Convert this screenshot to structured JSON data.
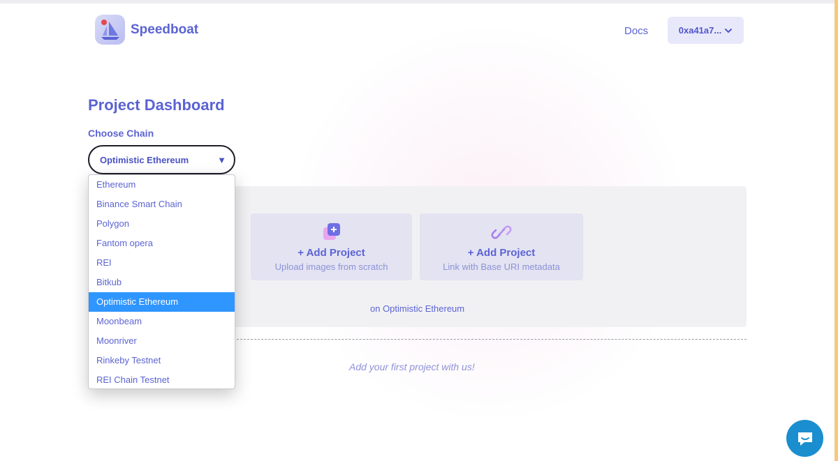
{
  "header": {
    "brand": "Speedboat",
    "docs_label": "Docs",
    "wallet_label": "0xa41a7..."
  },
  "main": {
    "title": "Project Dashboard",
    "choose_chain_label": "Choose Chain",
    "selected_chain": "Optimistic Ethereum",
    "chain_options": [
      "Ethereum",
      "Binance Smart Chain",
      "Polygon",
      "Fantom opera",
      "REI",
      "Bitkub",
      "Optimistic Ethereum",
      "Moonbeam",
      "Moonriver",
      "Rinkeby Testnet",
      "REI Chain Testnet"
    ],
    "cards": [
      {
        "title": "+ Add Project",
        "subtitle": "Upload images from scratch",
        "icon": "image-plus-icon"
      },
      {
        "title": "+ Add Project",
        "subtitle": "Link with Base URI metadata",
        "icon": "link-icon"
      }
    ],
    "chain_note": "on Optimistic Ethereum",
    "empty_message": "Add your first project with us!"
  },
  "colors": {
    "accent": "#5b63d3",
    "selected_option": "#2f95ff",
    "chat_button": "#1a8ecf"
  }
}
